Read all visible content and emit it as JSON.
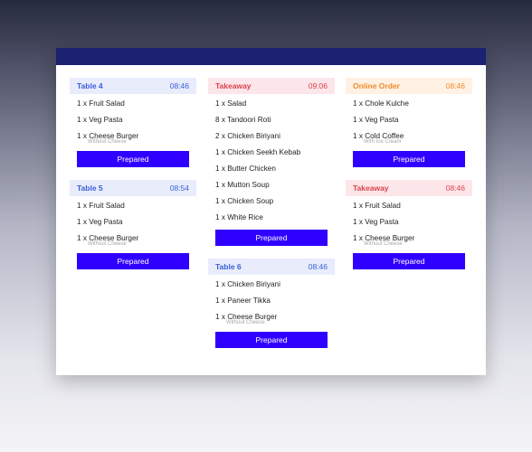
{
  "orders": {
    "col1": [
      {
        "title": "Table 4",
        "time": "08:46",
        "color": "blue",
        "items": [
          {
            "text": "1 x Fruit Salad"
          },
          {
            "text": "1 x Veg Pasta"
          },
          {
            "text": "1 x Cheese Burger",
            "note": "Without Cheese"
          }
        ],
        "action_label": "Prepared"
      },
      {
        "title": "Table 5",
        "time": "08:54",
        "color": "blue",
        "items": [
          {
            "text": "1 x Fruit Salad"
          },
          {
            "text": "1 x Veg Pasta"
          },
          {
            "text": "1 x Cheese Burger",
            "note": "Without Cheese"
          }
        ],
        "action_label": "Prepared"
      }
    ],
    "col2": [
      {
        "title": "Takeaway",
        "time": "09:06",
        "color": "pink",
        "items": [
          {
            "text": "1 x Salad"
          },
          {
            "text": "8 x Tandoori Roti"
          },
          {
            "text": "2 x Chicken Biriyani"
          },
          {
            "text": "1 x Chicken Seekh Kebab"
          },
          {
            "text": "1 x Butter Chicken"
          },
          {
            "text": "1 x Mutton Soup"
          },
          {
            "text": "1 x Chicken Soup"
          },
          {
            "text": "1 x White Rice"
          }
        ],
        "action_label": "Prepared"
      },
      {
        "title": "Table 6",
        "time": "08:46",
        "color": "blue",
        "items": [
          {
            "text": "1 x Chicken Biriyani"
          },
          {
            "text": "1 x Paneer Tikka"
          },
          {
            "text": "1 x Cheese Burger",
            "note": "Without Cheese"
          }
        ],
        "action_label": "Prepared"
      }
    ],
    "col3": [
      {
        "title": "Online Order",
        "time": "08:46",
        "color": "peach",
        "items": [
          {
            "text": "1 x Chole Kulche"
          },
          {
            "text": "1 x Veg Pasta"
          },
          {
            "text": "1 x Cold Coffee",
            "note": "With Ice Cream"
          }
        ],
        "action_label": "Prepared"
      },
      {
        "title": "Takeaway",
        "time": "08:46",
        "color": "pink",
        "items": [
          {
            "text": "1 x Fruit Salad"
          },
          {
            "text": "1 x Veg Pasta"
          },
          {
            "text": "1 x Cheese Burger",
            "note": "Without Cheese"
          }
        ],
        "action_label": "Prepared"
      }
    ]
  },
  "colors": {
    "topbar": "#1c2172",
    "button": "#2f00ff",
    "blue_header_bg": "#e8ecfb",
    "blue_header_fg": "#3a5fd9",
    "pink_header_bg": "#fce6ea",
    "pink_header_fg": "#d8434d",
    "peach_header_bg": "#fff1e4",
    "peach_header_fg": "#f08b2a"
  }
}
